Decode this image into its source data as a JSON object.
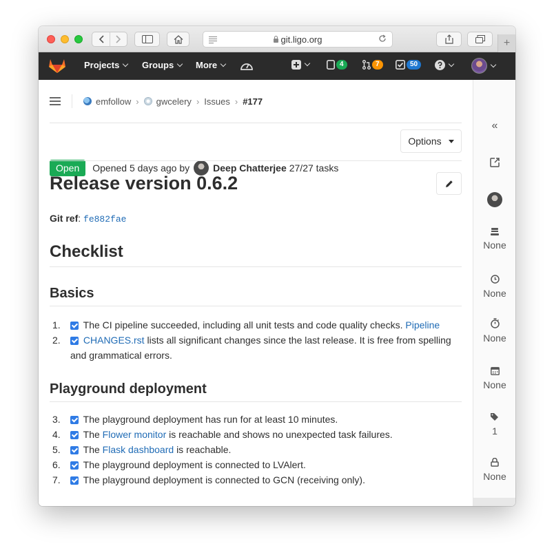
{
  "browser": {
    "url": "git.ligo.org",
    "new_tab_glyph": "+"
  },
  "navbar": {
    "projects": "Projects",
    "groups": "Groups",
    "more": "More",
    "todos_count": "4",
    "merge_requests_count": "7",
    "issues_count": "50",
    "colors": {
      "todos": "#1aaa55",
      "merge_requests": "#fc9403",
      "issues": "#1f78d1"
    }
  },
  "breadcrumb": {
    "group": "emfollow",
    "project": "gwcelery",
    "section": "Issues",
    "issue": "#177"
  },
  "issue": {
    "status": "Open",
    "opened_text": "Opened 5 days ago by",
    "author": "Deep Chatterjee",
    "tasks": "27/27 tasks",
    "options_label": "Options",
    "title": "Release version 0.6.2",
    "gitref_label": "Git ref",
    "gitref_colon": ":",
    "gitref_value": "fe882fae"
  },
  "body": {
    "checklist_heading": "Checklist",
    "basics_heading": "Basics",
    "basics_items": [
      {
        "num": "1.",
        "pre": "The CI pipeline succeeded, including all unit tests and code quality checks.",
        "link": "Pipeline",
        "post": ""
      },
      {
        "num": "2.",
        "pre": "",
        "link": "CHANGES.rst",
        "post": "lists all significant changes since the last release. It is free from spelling and grammatical errors."
      }
    ],
    "playground_heading": "Playground deployment",
    "playground_items": [
      {
        "num": "3.",
        "pre": "The playground deployment has run for at least 10 minutes.",
        "link": "",
        "post": ""
      },
      {
        "num": "4.",
        "pre": "The",
        "link": "Flower monitor",
        "post": "is reachable and shows no unexpected task failures."
      },
      {
        "num": "5.",
        "pre": "The",
        "link": "Flask dashboard",
        "post": "is reachable."
      },
      {
        "num": "6.",
        "pre": "The playground deployment is connected to LVAlert.",
        "link": "",
        "post": ""
      },
      {
        "num": "7.",
        "pre": "The playground deployment is connected to GCN (receiving only).",
        "link": "",
        "post": ""
      }
    ]
  },
  "sidebar": {
    "collapse_glyph": "«",
    "milestone": "None",
    "time_tracking": "None",
    "timer": "None",
    "due_date": "None",
    "labels": "1",
    "lock": "None"
  }
}
